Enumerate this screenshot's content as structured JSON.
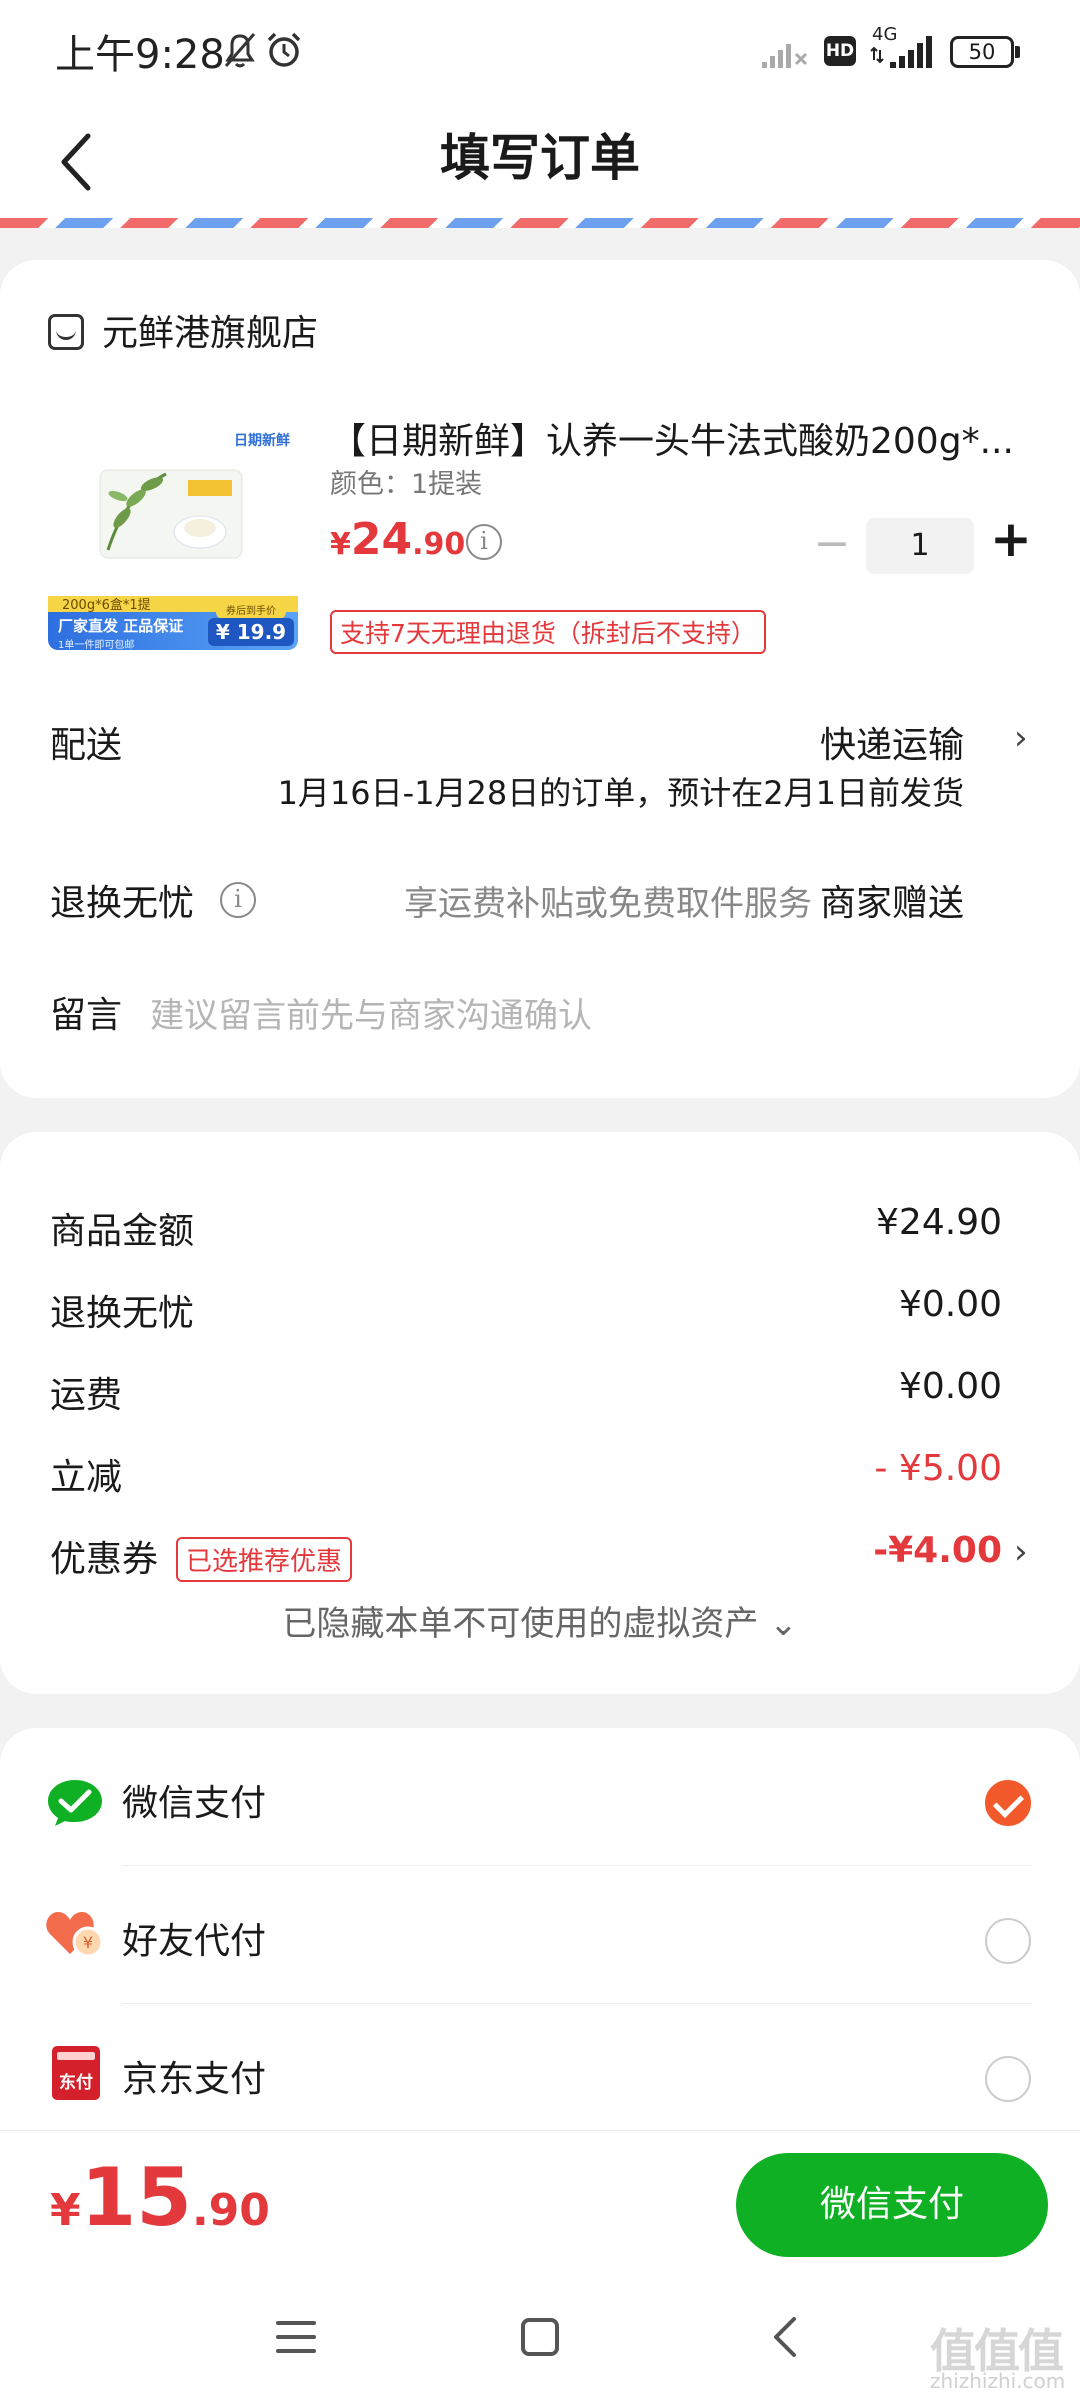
{
  "status_bar": {
    "time": "上午9:28",
    "network": "4G",
    "hd": "HD",
    "battery": "50"
  },
  "header": {
    "title": "填写订单"
  },
  "store": {
    "name": "元鲜港旗舰店"
  },
  "product": {
    "title": "【日期新鲜】认养一头牛法式酸奶200g*...",
    "spec": "颜色：1提装",
    "price_symbol": "¥",
    "price_int": "24",
    "price_dec": ".90",
    "quantity": "1",
    "return_badge": "支持7天无理由退货（拆封后不支持）",
    "image_text": {
      "top_tag": "日期新鲜",
      "pack": "200g*6盒*1提",
      "banner": "厂家直发 正品保证",
      "sub": "1单一件即可包邮",
      "price_label": "券后到手价",
      "price": "¥ 19.9"
    }
  },
  "delivery": {
    "label": "配送",
    "method": "快递运输",
    "note": "1月16日-1月28日的订单，预计在2月1日前发货"
  },
  "worry_free": {
    "label": "退换无忧",
    "desc": "享运费补贴或免费取件服务",
    "value": "商家赠送"
  },
  "message": {
    "label": "留言",
    "placeholder": "建议留言前先与商家沟通确认"
  },
  "summary": {
    "rows": [
      {
        "label": "商品金额",
        "value": "¥24.90"
      },
      {
        "label": "退换无忧",
        "value": "¥0.00"
      },
      {
        "label": "运费",
        "value": "¥0.00"
      },
      {
        "label": "立减",
        "value": "- ¥5.00"
      },
      {
        "label": "优惠券",
        "value": "-¥4.00"
      }
    ],
    "coupon_badge": "已选推荐优惠",
    "hidden_assets": "已隐藏本单不可使用的虚拟资产 ⌄"
  },
  "payment": {
    "methods": [
      {
        "label": "微信支付",
        "selected": true,
        "icon": "wechat-pay-icon"
      },
      {
        "label": "好友代付",
        "selected": false,
        "icon": "friend-pay-icon"
      },
      {
        "label": "京东支付",
        "selected": false,
        "icon": "jd-pay-icon"
      }
    ],
    "jd_icon_text": "东付"
  },
  "bottom": {
    "total_symbol": "¥",
    "total_int": "15",
    "total_dec": ".90",
    "pay_button": "微信支付"
  },
  "watermark": {
    "main": "值值值",
    "sub": "zhizhizhi.com"
  },
  "colors": {
    "accent_red": "#e4393c",
    "wechat_green": "#10b025",
    "radio_selected": "#f25a2c"
  }
}
